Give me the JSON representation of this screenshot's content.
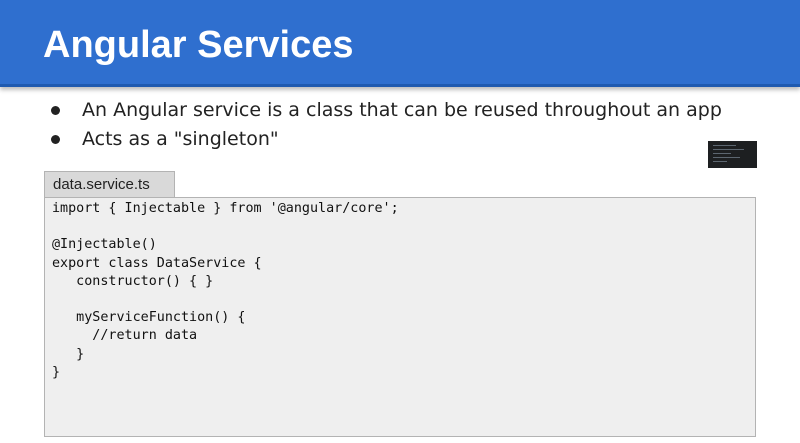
{
  "slide": {
    "title": "Angular Services",
    "bullets": [
      "An Angular service is a class that can be reused throughout an app",
      "Acts as a \"singleton\""
    ]
  },
  "code_file": {
    "filename": "data.service.ts",
    "lines": [
      "import { Injectable } from '@angular/core';",
      "",
      "@Injectable()",
      "export class DataService {",
      "   constructor() { }",
      "",
      "   myServiceFunction() {",
      "     //return data",
      "   }",
      "}"
    ]
  },
  "colors": {
    "header_bg": "#2f6fcf",
    "code_bg": "#efefef",
    "tab_bg": "#d9d9d9"
  }
}
